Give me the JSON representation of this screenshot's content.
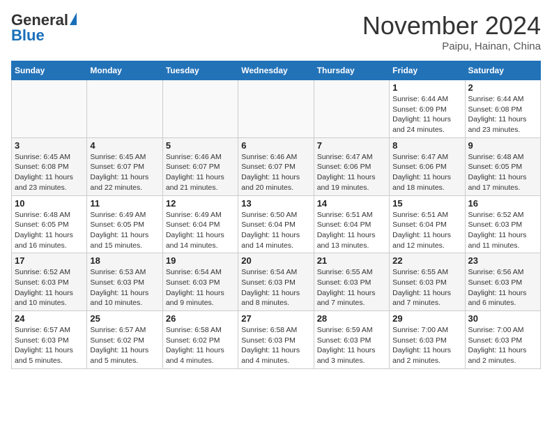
{
  "logo": {
    "general": "General",
    "blue": "Blue"
  },
  "title": "November 2024",
  "subtitle": "Paipu, Hainan, China",
  "headers": [
    "Sunday",
    "Monday",
    "Tuesday",
    "Wednesday",
    "Thursday",
    "Friday",
    "Saturday"
  ],
  "weeks": [
    [
      {
        "day": "",
        "info": ""
      },
      {
        "day": "",
        "info": ""
      },
      {
        "day": "",
        "info": ""
      },
      {
        "day": "",
        "info": ""
      },
      {
        "day": "",
        "info": ""
      },
      {
        "day": "1",
        "info": "Sunrise: 6:44 AM\nSunset: 6:09 PM\nDaylight: 11 hours and 24 minutes."
      },
      {
        "day": "2",
        "info": "Sunrise: 6:44 AM\nSunset: 6:08 PM\nDaylight: 11 hours and 23 minutes."
      }
    ],
    [
      {
        "day": "3",
        "info": "Sunrise: 6:45 AM\nSunset: 6:08 PM\nDaylight: 11 hours and 23 minutes."
      },
      {
        "day": "4",
        "info": "Sunrise: 6:45 AM\nSunset: 6:07 PM\nDaylight: 11 hours and 22 minutes."
      },
      {
        "day": "5",
        "info": "Sunrise: 6:46 AM\nSunset: 6:07 PM\nDaylight: 11 hours and 21 minutes."
      },
      {
        "day": "6",
        "info": "Sunrise: 6:46 AM\nSunset: 6:07 PM\nDaylight: 11 hours and 20 minutes."
      },
      {
        "day": "7",
        "info": "Sunrise: 6:47 AM\nSunset: 6:06 PM\nDaylight: 11 hours and 19 minutes."
      },
      {
        "day": "8",
        "info": "Sunrise: 6:47 AM\nSunset: 6:06 PM\nDaylight: 11 hours and 18 minutes."
      },
      {
        "day": "9",
        "info": "Sunrise: 6:48 AM\nSunset: 6:05 PM\nDaylight: 11 hours and 17 minutes."
      }
    ],
    [
      {
        "day": "10",
        "info": "Sunrise: 6:48 AM\nSunset: 6:05 PM\nDaylight: 11 hours and 16 minutes."
      },
      {
        "day": "11",
        "info": "Sunrise: 6:49 AM\nSunset: 6:05 PM\nDaylight: 11 hours and 15 minutes."
      },
      {
        "day": "12",
        "info": "Sunrise: 6:49 AM\nSunset: 6:04 PM\nDaylight: 11 hours and 14 minutes."
      },
      {
        "day": "13",
        "info": "Sunrise: 6:50 AM\nSunset: 6:04 PM\nDaylight: 11 hours and 14 minutes."
      },
      {
        "day": "14",
        "info": "Sunrise: 6:51 AM\nSunset: 6:04 PM\nDaylight: 11 hours and 13 minutes."
      },
      {
        "day": "15",
        "info": "Sunrise: 6:51 AM\nSunset: 6:04 PM\nDaylight: 11 hours and 12 minutes."
      },
      {
        "day": "16",
        "info": "Sunrise: 6:52 AM\nSunset: 6:03 PM\nDaylight: 11 hours and 11 minutes."
      }
    ],
    [
      {
        "day": "17",
        "info": "Sunrise: 6:52 AM\nSunset: 6:03 PM\nDaylight: 11 hours and 10 minutes."
      },
      {
        "day": "18",
        "info": "Sunrise: 6:53 AM\nSunset: 6:03 PM\nDaylight: 11 hours and 10 minutes."
      },
      {
        "day": "19",
        "info": "Sunrise: 6:54 AM\nSunset: 6:03 PM\nDaylight: 11 hours and 9 minutes."
      },
      {
        "day": "20",
        "info": "Sunrise: 6:54 AM\nSunset: 6:03 PM\nDaylight: 11 hours and 8 minutes."
      },
      {
        "day": "21",
        "info": "Sunrise: 6:55 AM\nSunset: 6:03 PM\nDaylight: 11 hours and 7 minutes."
      },
      {
        "day": "22",
        "info": "Sunrise: 6:55 AM\nSunset: 6:03 PM\nDaylight: 11 hours and 7 minutes."
      },
      {
        "day": "23",
        "info": "Sunrise: 6:56 AM\nSunset: 6:03 PM\nDaylight: 11 hours and 6 minutes."
      }
    ],
    [
      {
        "day": "24",
        "info": "Sunrise: 6:57 AM\nSunset: 6:03 PM\nDaylight: 11 hours and 5 minutes."
      },
      {
        "day": "25",
        "info": "Sunrise: 6:57 AM\nSunset: 6:02 PM\nDaylight: 11 hours and 5 minutes."
      },
      {
        "day": "26",
        "info": "Sunrise: 6:58 AM\nSunset: 6:02 PM\nDaylight: 11 hours and 4 minutes."
      },
      {
        "day": "27",
        "info": "Sunrise: 6:58 AM\nSunset: 6:03 PM\nDaylight: 11 hours and 4 minutes."
      },
      {
        "day": "28",
        "info": "Sunrise: 6:59 AM\nSunset: 6:03 PM\nDaylight: 11 hours and 3 minutes."
      },
      {
        "day": "29",
        "info": "Sunrise: 7:00 AM\nSunset: 6:03 PM\nDaylight: 11 hours and 2 minutes."
      },
      {
        "day": "30",
        "info": "Sunrise: 7:00 AM\nSunset: 6:03 PM\nDaylight: 11 hours and 2 minutes."
      }
    ]
  ]
}
